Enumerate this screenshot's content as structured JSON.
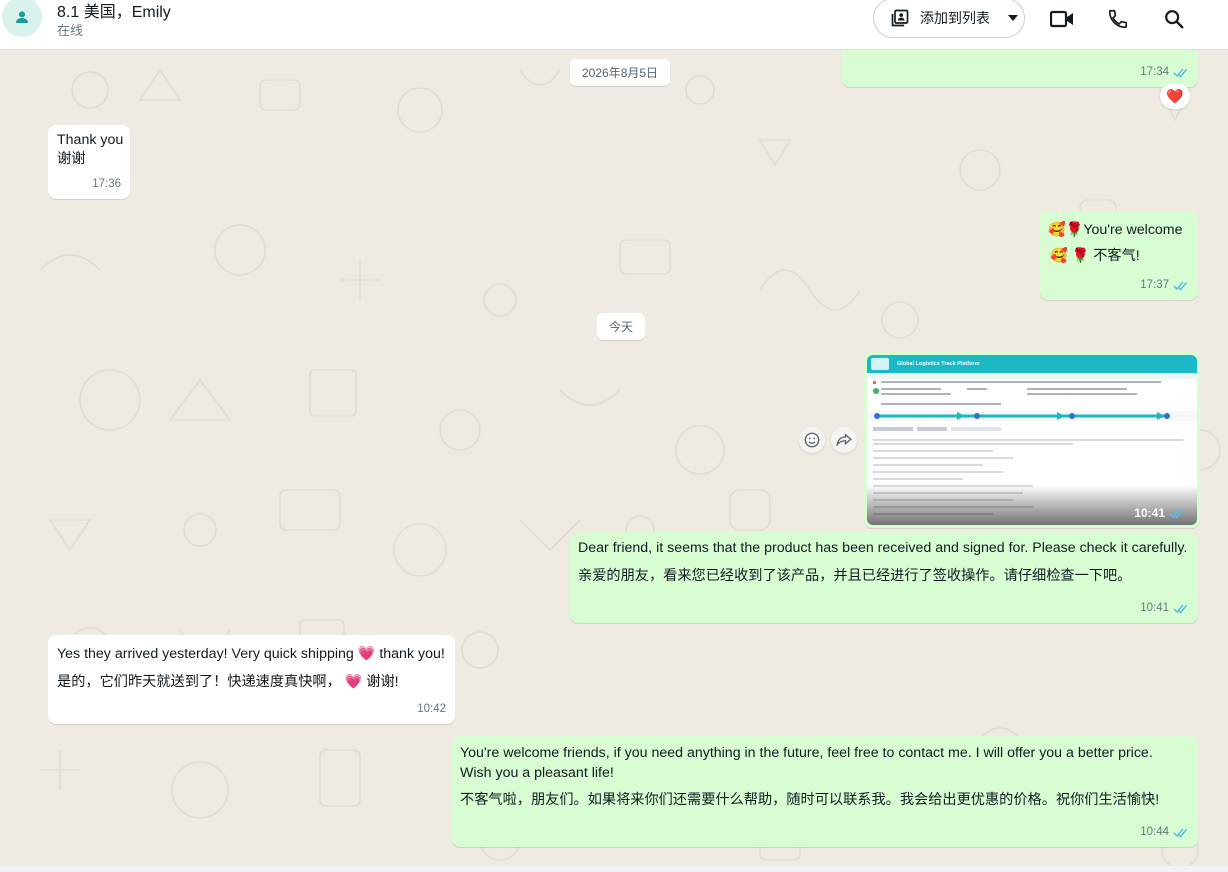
{
  "header": {
    "contact_name": "8.1 美国，Emily",
    "status": "在线",
    "add_to_list": "添加到列表",
    "icons": [
      "person-icon",
      "add-list-icon",
      "chevron-down-icon",
      "video-call-icon",
      "phone-icon",
      "search-icon"
    ]
  },
  "colors": {
    "incoming_bubble": "#ffffff",
    "outgoing_bubble": "#d9fdd3",
    "read_tick": "#53bdeb",
    "background": "#efeae2",
    "header": "#ffffff"
  },
  "dates": {
    "first": "2026年8月5日",
    "today": "今天"
  },
  "messages": [
    {
      "dir": "out",
      "time": "17:34",
      "reaction": "❤️"
    },
    {
      "dir": "in",
      "lines": [
        "Thank you",
        "谢谢"
      ],
      "time": "17:36"
    },
    {
      "dir": "out",
      "lines": [
        "🥰🌹You're welcome",
        "🥰 🌹 不客气!"
      ],
      "time": "17:37"
    },
    {
      "dir": "out",
      "type": "image",
      "image_title": "Global Logistics Track Platform",
      "time": "10:41"
    },
    {
      "dir": "out",
      "lines": [
        "Dear friend, it seems that the product has been received and signed for. Please check it carefully.",
        "亲爱的朋友，看来您已经收到了该产品，并且已经进行了签收操作。请仔细检查一下吧。"
      ],
      "time": "10:41"
    },
    {
      "dir": "in",
      "lines": [
        "Yes they arrived yesterday! Very quick shipping 💗 thank you!",
        "是的，它们昨天就送到了！快递速度真快啊， 💗 谢谢!"
      ],
      "time": "10:42"
    },
    {
      "dir": "out",
      "lines": [
        "You're welcome friends, if you need anything in the future, feel free to contact me. I will offer you a better price.",
        "Wish you a pleasant life!",
        "不客气啦，朋友们。如果将来你们还需要什么帮助，随时可以联系我。我会给出更优惠的价格。祝你们生活愉快!"
      ],
      "time": "10:44"
    }
  ]
}
